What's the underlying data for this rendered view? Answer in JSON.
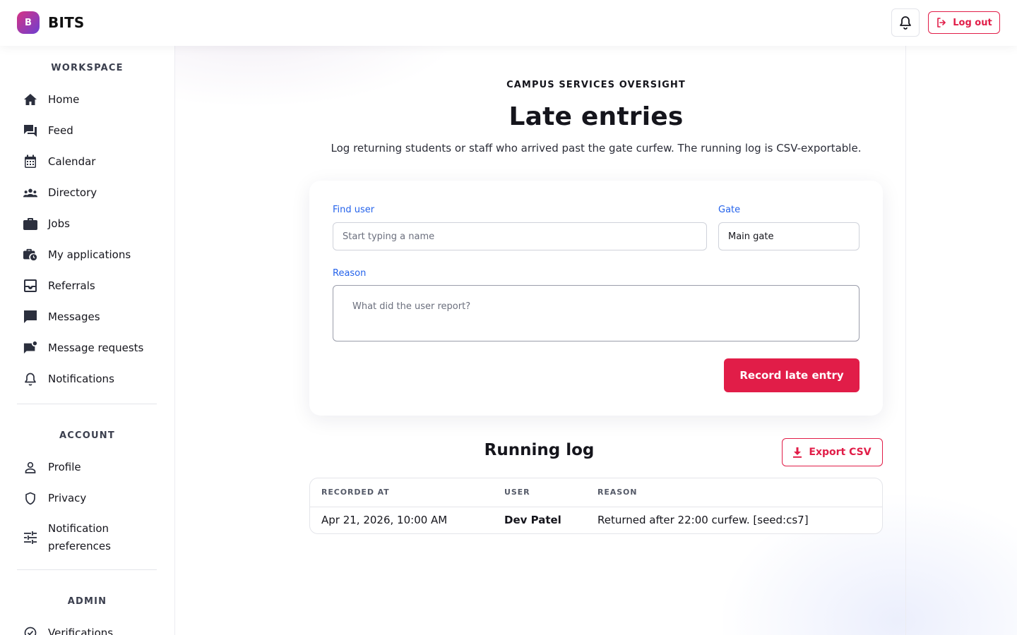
{
  "app": {
    "logo_letter": "B",
    "name": "BITS"
  },
  "topbar": {
    "notifications_icon": "bell-icon",
    "logout_label": "Log out",
    "logout_icon": "logout-icon"
  },
  "sidebar": {
    "sections": [
      {
        "title": "WORKSPACE",
        "items": [
          {
            "label": "Home",
            "icon": "home-icon"
          },
          {
            "label": "Feed",
            "icon": "forum-icon"
          },
          {
            "label": "Calendar",
            "icon": "calendar-icon"
          },
          {
            "label": "Directory",
            "icon": "groups-icon"
          },
          {
            "label": "Jobs",
            "icon": "briefcase-icon"
          },
          {
            "label": "My applications",
            "icon": "work-history-icon"
          },
          {
            "label": "Referrals",
            "icon": "inbox-icon"
          },
          {
            "label": "Messages",
            "icon": "chat-icon"
          },
          {
            "label": "Message requests",
            "icon": "mark-chat-icon"
          },
          {
            "label": "Notifications",
            "icon": "bell-icon"
          }
        ]
      },
      {
        "title": "ACCOUNT",
        "items": [
          {
            "label": "Profile",
            "icon": "person-icon"
          },
          {
            "label": "Privacy",
            "icon": "shield-icon"
          },
          {
            "label": "Notification preferences",
            "icon": "tune-icon"
          }
        ]
      },
      {
        "title": "ADMIN",
        "items": [
          {
            "label": "Verifications",
            "icon": "verified-icon"
          }
        ]
      }
    ]
  },
  "page": {
    "eyebrow": "CAMPUS SERVICES OVERSIGHT",
    "title": "Late entries",
    "subtitle": "Log returning students or staff who arrived past the gate curfew. The running log is CSV-exportable."
  },
  "form": {
    "find_user_label": "Find user",
    "find_user_placeholder": "Start typing a name",
    "gate_label": "Gate",
    "gate_value": "Main gate",
    "reason_label": "Reason",
    "reason_placeholder": "What did the user report?",
    "submit_label": "Record late entry"
  },
  "log": {
    "title": "Running log",
    "export_label": "Export CSV",
    "export_icon": "download-icon",
    "columns": [
      "RECORDED AT",
      "USER",
      "REASON"
    ],
    "rows": [
      {
        "recorded_at": "Apr 21, 2026, 10:00 AM",
        "user": "Dev Patel",
        "reason": "Returned after 22:00 curfew. [seed:cs7]"
      }
    ]
  },
  "colors": {
    "accent": "#e11d48",
    "label_blue": "#2563eb",
    "logo_gradient_start": "#d63384",
    "logo_gradient_end": "#6d3fd1"
  }
}
